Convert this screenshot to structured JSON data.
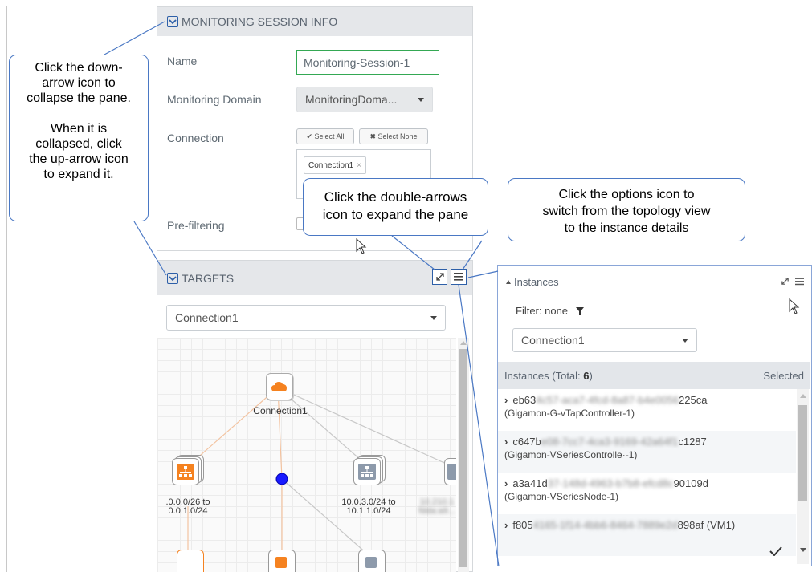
{
  "session": {
    "header": "MONITORING SESSION INFO",
    "name_label": "Name",
    "name_value": "Monitoring-Session-1",
    "domain_label": "Monitoring Domain",
    "domain_value": "MonitoringDoma...",
    "connection_label": "Connection",
    "select_all": "✔ Select All",
    "select_none": "✖ Select None",
    "connection_tag": "Connection1",
    "prefiltering_label": "Pre-filtering"
  },
  "targets": {
    "header": "TARGETS",
    "dropdown_value": "Connection1",
    "nodes": {
      "cloud_label": "Connection1",
      "left_label_1": ".0.0.0/26 to",
      "left_label_2": "0.0.1.0/24",
      "mid_label_1": "10.0.3.0/24 to",
      "mid_label_2": "10.1.1.0/24",
      "right_label_1": "10.210.1",
      "right_label_2": "fdda:a9..."
    }
  },
  "instances": {
    "header": "Instances",
    "filter_text": "Filter: none",
    "dropdown_value": "Connection1",
    "total_label": "Instances (Total: ",
    "total_count": "6",
    "total_close": ")",
    "selected_label": "Selected",
    "rows": [
      {
        "id_start": "eb63",
        "id_mid": "4c57-aca7-4fcd-8a87-b4e0056",
        "id_end": "225ca",
        "sub": "(Gigamon-G-vTapController-1)"
      },
      {
        "id_start": "c647b",
        "id_mid": "e08-7cc7-4ca3-9169-42a64f1",
        "id_end": "c1287",
        "sub": "(Gigamon-VSeriesControlle·-1)"
      },
      {
        "id_start": "a3a41d",
        "id_mid": "37-148d-4963-b7b8-efcd8c",
        "id_end": "90109d",
        "sub": "(Gigamon-VSeriesNode-1)"
      },
      {
        "id_start": "f805",
        "id_mid": "4165-1f14-4bb6-8464-7889e2d",
        "id_end": "898af (VM1)",
        "sub": ""
      }
    ]
  },
  "callouts": {
    "collapse_lines": [
      "Click the down-",
      "arrow icon to",
      "collapse the pane.",
      "",
      "When it is",
      "collapsed, click",
      "the up-arrow icon",
      "to expand it."
    ],
    "expand_lines": [
      "Click the double-arrows",
      "icon to expand the pane"
    ],
    "options_lines": [
      "Click the options icon to",
      "switch from the topology view",
      "to the instance details"
    ]
  },
  "colors": {
    "accent_blue": "#2d5fa8",
    "callout_border": "#4a78c4",
    "orange": "#f58220",
    "header_grey": "#e5e7ea",
    "green_border": "#34a853"
  },
  "icons": [
    "checkbox-collapse-icon",
    "expand-arrows-icon",
    "options-menu-icon",
    "filter-funnel-icon",
    "cursor-arrow-icon",
    "cloud-icon",
    "network-tree-icon",
    "checkmark-icon"
  ]
}
